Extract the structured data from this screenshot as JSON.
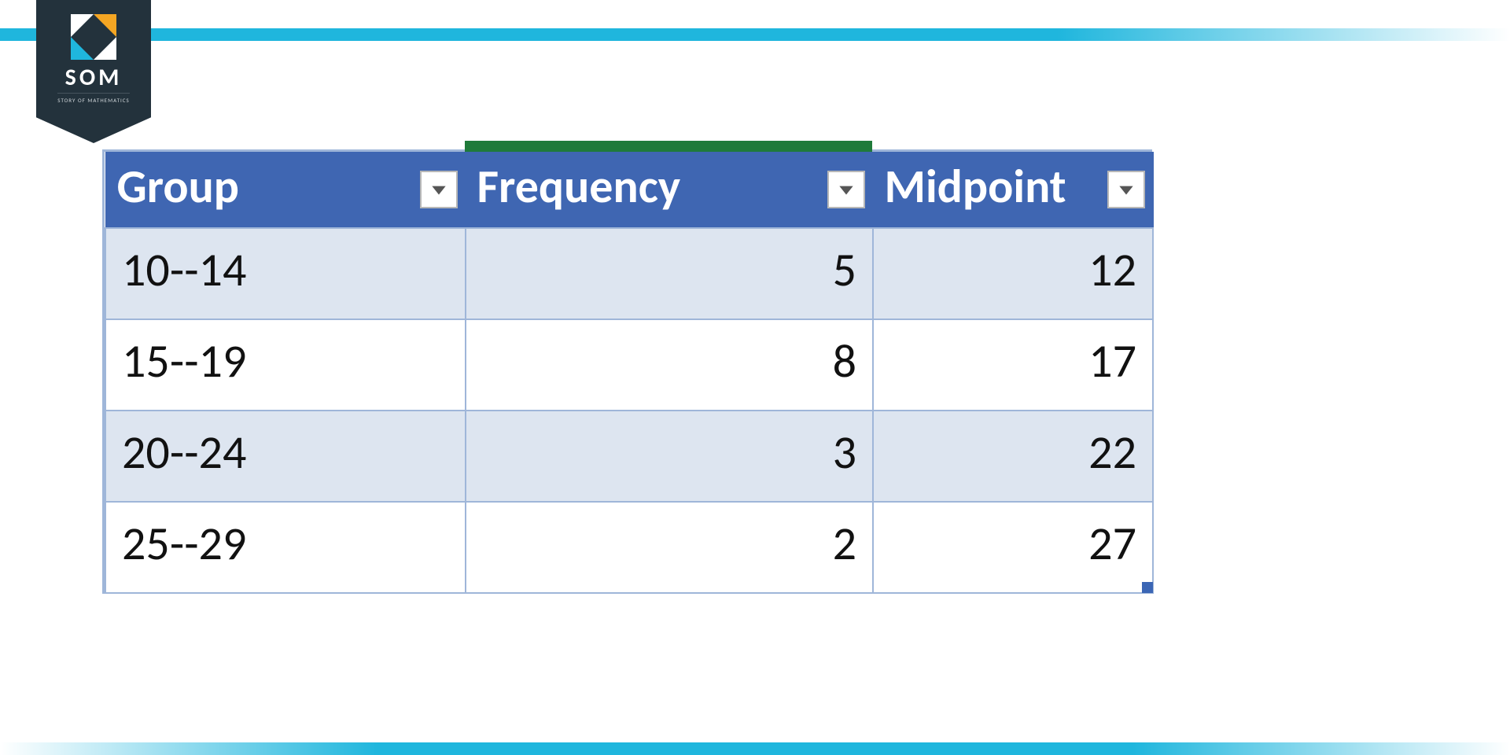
{
  "logo": {
    "text": "SOM",
    "subtitle": "STORY OF MATHEMATICS"
  },
  "table": {
    "headers": [
      "Group",
      "Frequency",
      "Midpoint"
    ],
    "rows": [
      {
        "group": "10--14",
        "frequency": 5,
        "midpoint": 12
      },
      {
        "group": "15--19",
        "frequency": 8,
        "midpoint": 17
      },
      {
        "group": "20--24",
        "frequency": 3,
        "midpoint": 22
      },
      {
        "group": "25--29",
        "frequency": 2,
        "midpoint": 27
      }
    ]
  }
}
